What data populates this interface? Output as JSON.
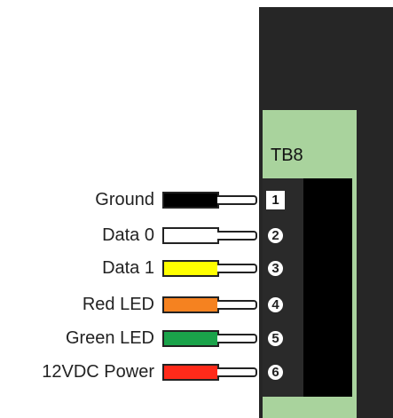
{
  "terminal": {
    "label": "TB8"
  },
  "wires": [
    {
      "label": "Ground",
      "color": "#000000",
      "pin": "1"
    },
    {
      "label": "Data 0",
      "color": "#ffffff",
      "pin": "2"
    },
    {
      "label": "Data 1",
      "color": "#ffff00",
      "pin": "3"
    },
    {
      "label": "Red LED",
      "color": "#f58220",
      "pin": "4"
    },
    {
      "label": "Green LED",
      "color": "#1aa34a",
      "pin": "5"
    },
    {
      "label": "12VDC Power",
      "color": "#ff2a1a",
      "pin": "6"
    }
  ],
  "colors": {
    "board": "#262626",
    "connector": "#a9d39d",
    "terminal_block": "#000000"
  }
}
